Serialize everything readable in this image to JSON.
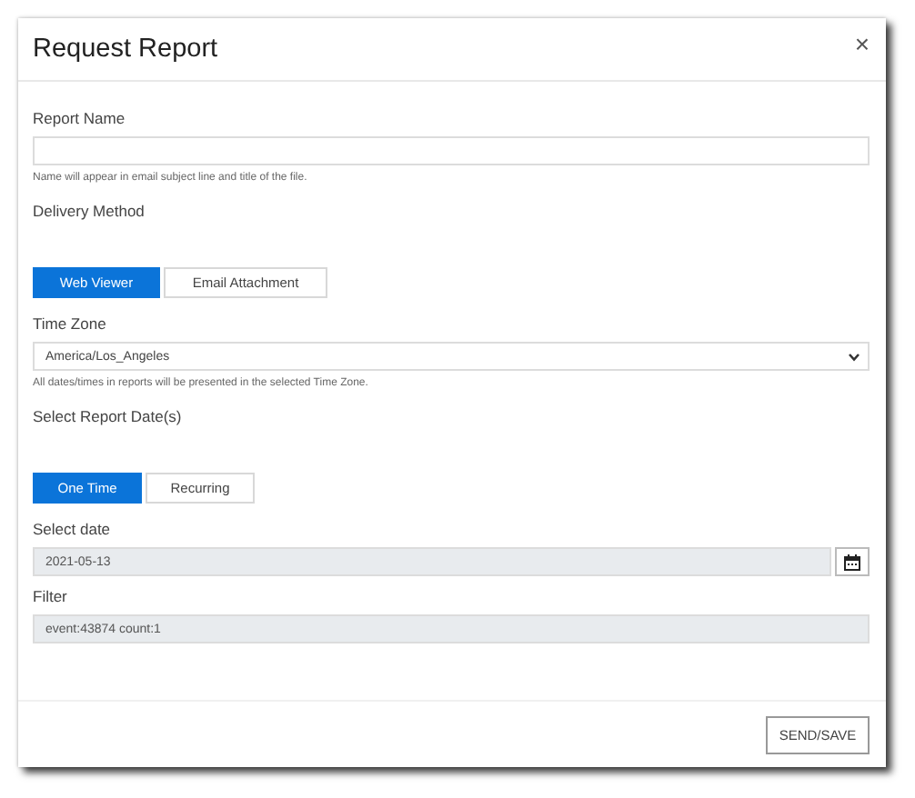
{
  "dialog": {
    "title": "Request Report",
    "close": "×"
  },
  "report_name": {
    "label": "Report Name",
    "hint": "Name will appear in email subject line and title of the file."
  },
  "delivery_method": {
    "label": "Delivery Method",
    "options": [
      {
        "label": "Web Viewer",
        "selected": true
      },
      {
        "label": "Email Attachment",
        "selected": false
      }
    ]
  },
  "time_zone": {
    "label": "Time Zone",
    "value": "America/Los_Angeles",
    "hint": "All dates/times in reports will be presented in the selected Time Zone."
  },
  "report_dates": {
    "label": "Select Report Date(s)",
    "options": [
      {
        "label": "One Time",
        "selected": true
      },
      {
        "label": "Recurring",
        "selected": false
      }
    ]
  },
  "select_date": {
    "label": "Select date",
    "value": "2021-05-13"
  },
  "filter": {
    "label": "Filter",
    "value": "event:43874 count:1"
  },
  "footer": {
    "button": "SEND/SAVE"
  }
}
